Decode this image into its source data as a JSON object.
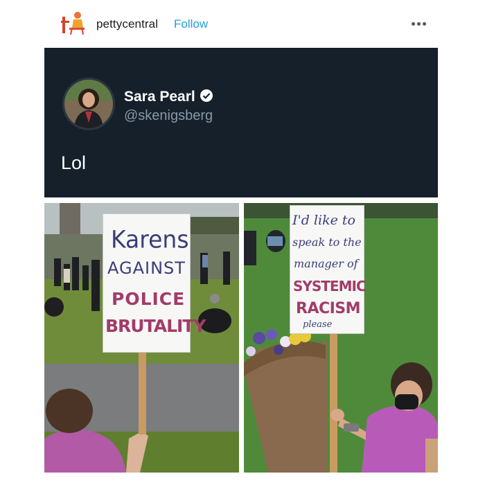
{
  "post": {
    "blog_name": "pettycentral",
    "follow_label": "Follow",
    "more_icon": "more-horizontal-icon"
  },
  "tweet": {
    "display_name": "Sara Pearl",
    "handle": "@skenigsberg",
    "text": "Lol",
    "verified_icon": "verified-badge-icon",
    "colors": {
      "background": "#15202b",
      "handle": "#8899a6",
      "verified": "#ffffff"
    }
  },
  "photos": {
    "left_sign": {
      "line1": "Karens",
      "line2": "AGAINST",
      "line3": "POLICE",
      "line4": "BRUTALITY"
    },
    "right_sign": {
      "line1": "I'd like to",
      "line2": "speak to the",
      "line3": "manager of",
      "line4": "SYSTEMIC",
      "line5": "RACISM",
      "line6": "please"
    }
  },
  "colors": {
    "follow": "#1fa0d8",
    "sign_accent": "#a23c68"
  }
}
